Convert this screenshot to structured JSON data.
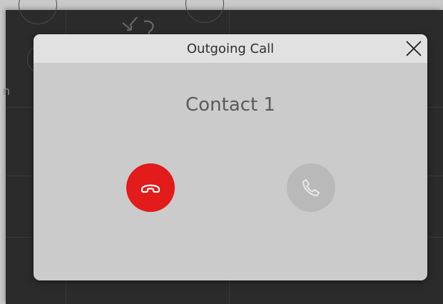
{
  "dialog": {
    "title": "Outgoing Call",
    "contact_name": "Contact 1"
  },
  "background": {
    "partial_text": "n"
  },
  "icons": {
    "close": "close-icon",
    "hangup": "phone-hangup-icon",
    "answer": "phone-answer-icon"
  },
  "colors": {
    "hangup": "#e21b1b",
    "answer_disabled": "#b9b9b9",
    "dialog_body": "#cbcbcb",
    "title_bar": "#e1e1e1",
    "background_app": "#2b2b2b"
  }
}
